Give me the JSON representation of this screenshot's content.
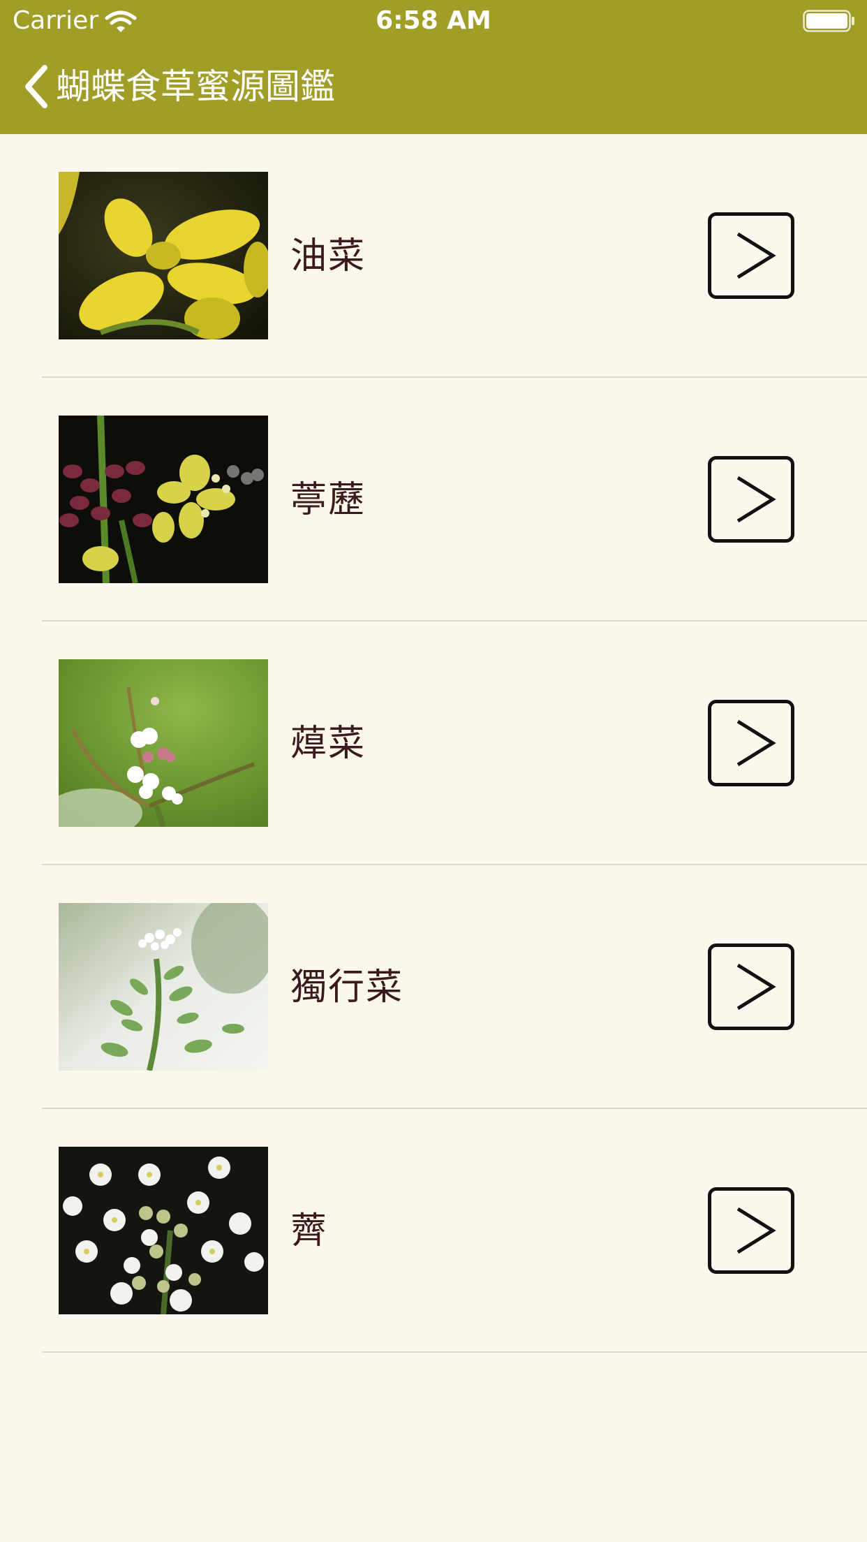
{
  "status_bar": {
    "carrier": "Carrier",
    "time": "6:58 AM",
    "wifi_icon": "wifi-icon",
    "battery_icon": "battery-icon"
  },
  "nav": {
    "back_icon": "chevron-left-icon",
    "title": "蝴蝶食草蜜源圖鑑"
  },
  "colors": {
    "header": "#a09e27",
    "background": "#fdf8ee",
    "label": "#3a1a1a"
  },
  "items": [
    {
      "label": "油菜"
    },
    {
      "label": "葶藶"
    },
    {
      "label": "蔊菜"
    },
    {
      "label": "獨行菜"
    },
    {
      "label": "薺"
    }
  ]
}
